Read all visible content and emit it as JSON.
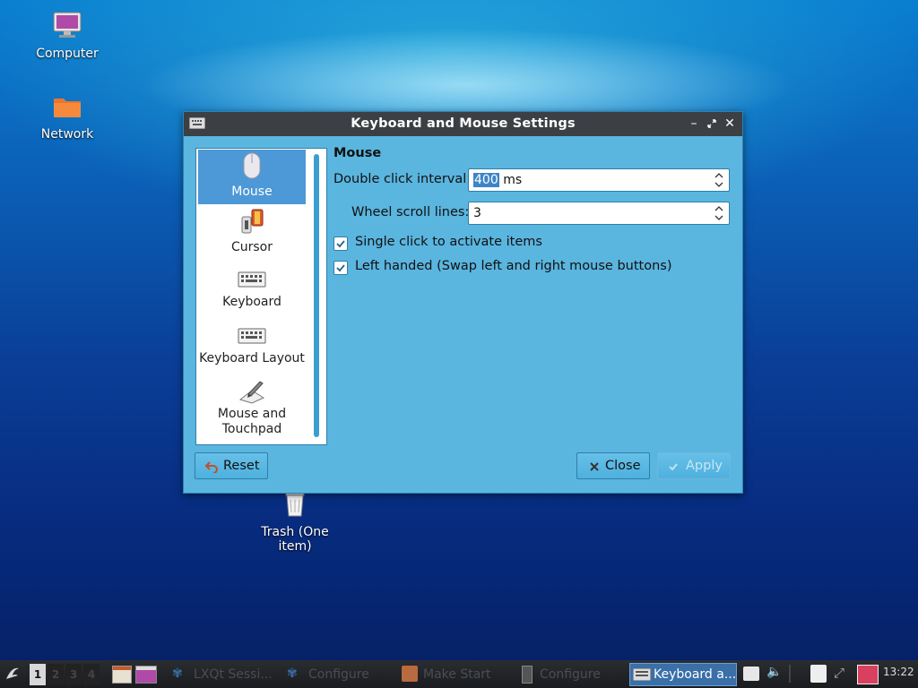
{
  "desktop": {
    "icons": [
      {
        "label": "Computer"
      },
      {
        "label": "Network"
      },
      {
        "label": "Trash (One item)"
      }
    ]
  },
  "window": {
    "title": "Keyboard and Mouse Settings",
    "sidebar": {
      "items": [
        {
          "label": "Mouse",
          "icon": "mouse-icon",
          "selected": true
        },
        {
          "label": "Cursor",
          "icon": "cursor-icon"
        },
        {
          "label": "Keyboard",
          "icon": "keyboard-icon"
        },
        {
          "label": "Keyboard Layout",
          "icon": "keyboard-layout-icon"
        },
        {
          "label_line1": "Mouse and",
          "label_line2": "Touchpad",
          "icon": "touchpad-icon"
        }
      ]
    },
    "mouse": {
      "heading": "Mouse",
      "double_click_label": "Double click interval:",
      "double_click_value": "400",
      "double_click_unit": "ms",
      "wheel_label": "Wheel scroll lines:",
      "wheel_value": "3",
      "single_click_label": "Single click to activate items",
      "single_click_checked": true,
      "left_handed_label": "Left handed (Swap left and right mouse buttons)",
      "left_handed_checked": true
    },
    "buttons": {
      "reset": "Reset",
      "close": "Close",
      "apply": "Apply"
    }
  },
  "taskbar": {
    "workspaces": [
      "1",
      "2",
      "3",
      "4"
    ],
    "tasks": [
      {
        "label": "LXQt Sessi..."
      },
      {
        "label": "Configure"
      },
      {
        "label": "Make Start"
      },
      {
        "label": "Configure"
      },
      {
        "label": "Keyboard a...",
        "active": true
      }
    ],
    "clock": "13:22"
  },
  "colors": {
    "window_bg": "#5ab5df",
    "titlebar_bg": "#3c3f44",
    "selection": "#4d98d6"
  }
}
